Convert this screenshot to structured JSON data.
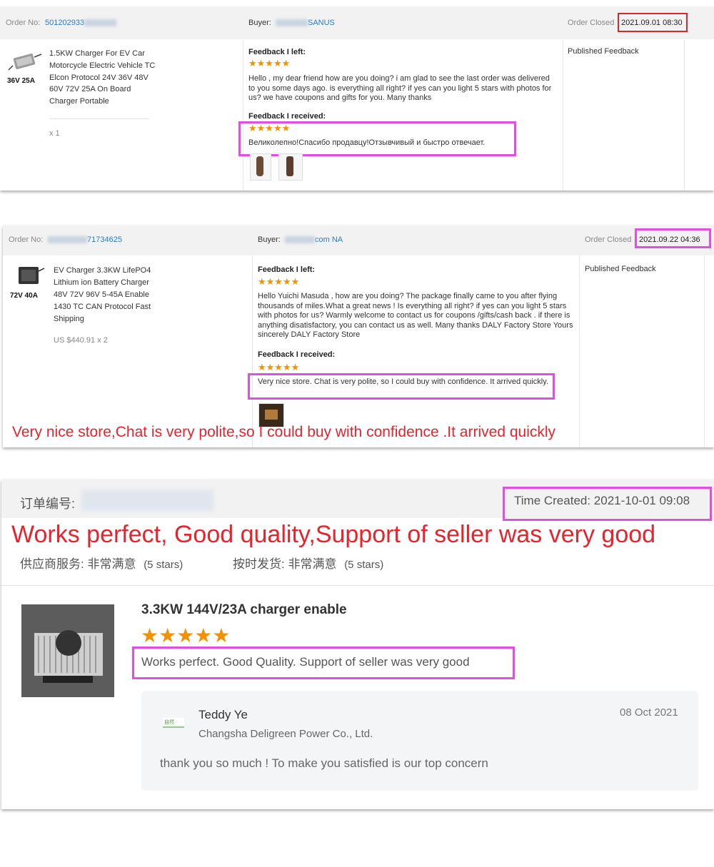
{
  "orders": [
    {
      "order_no_label": "Order No:",
      "order_no_value": "501202933",
      "buyer_label": "Buyer:",
      "buyer_value": "SANUS",
      "closed_label": "Order Closed",
      "closed_value": "2021.09.01 08:30",
      "product_tag": "36V 25A",
      "product_title": "1.5KW Charger For EV Car Motorcycle Electric Vehicle TC Elcon Protocol 24V 36V 48V 60V 72V 25A On Board Charger Portable",
      "qty": "x 1",
      "left_label": "Feedback I left:",
      "left_stars": "★★★★★",
      "left_text": "Hello , my dear friend how are you doing? i am glad to see the last order was delivered to you some days ago. is everything all right? if yes can you light 5 stars with photos for us? we have coupons and gifts for you. Many thanks",
      "received_label": "Feedback I received:",
      "received_stars": "★★★★★",
      "received_text": "Великолепно!Спасибо продавцу!Отзывчивый и быстро отвечает.",
      "status": "Published Feedback"
    },
    {
      "order_no_label": "Order No:",
      "order_no_value": "71734625",
      "buyer_label": "Buyer:",
      "buyer_value": "com NA",
      "closed_label": "Order Closed",
      "closed_value": "2021.09.22 04:36",
      "product_tag": "72V 40A",
      "product_title": "EV Charger 3.3KW LifePO4 Lithium ion Battery Charger 48V 72V 96V 5-45A Enable 1430 TC CAN Protocol Fast Shipping",
      "price": "US $440.91 x 2",
      "left_label": "Feedback I left:",
      "left_stars": "★★★★★",
      "left_text": "Hello Yuichi Masuda , how are you doing? The package finally came to you after flying thousands of miles.What a great news ! Is everything all right? if yes can you light 5 stars with photos for us? Warmly welcome to contact us for coupons /gifts/cash back . if there is anything disatisfactory, you can contact us as well. Many thanks DALY Factory Store Yours sincerely DALY Factory Store",
      "received_label": "Feedback I received:",
      "received_stars": "★★★★★",
      "received_text": "Very nice store. Chat is very polite, so I could buy with confidence. It arrived quickly.",
      "status": "Published Feedback",
      "overlay_caption": "Very nice store,Chat is very polite,so I could buy with confidence .It arrived quickly"
    }
  ],
  "third": {
    "order_label": "订单编号:",
    "time_created": "Time Created: 2021-10-01 09:08",
    "headline": "Works perfect, Good quality,Support of seller was very good",
    "rating1_label": "供应商服务: 非常满意",
    "rating1_value": "(5 stars)",
    "rating2_label": "按时发货: 非常满意",
    "rating2_value": "(5 stars)",
    "product_title": "3.3KW 144V/23A charger enable",
    "stars": "★★★★★",
    "review_text": "Works perfect. Good Quality. Support of seller was very good",
    "reply_name": "Teddy Ye",
    "reply_company": "Changsha Deligreen Power Co., Ltd.",
    "reply_date": "08 Oct 2021",
    "reply_text": "thank you so much ! To make you satisfied is our top concern"
  },
  "colors": {
    "highlight_pink": "#e14fe0",
    "highlight_red": "#d42a2a",
    "overlay_red": "#e8232b",
    "star_orange": "#f39200",
    "link_blue": "#2a7bc4"
  },
  "icons": [
    "charger-product-image",
    "buyer-photo-thumbnail",
    "seller-logo-icon"
  ]
}
